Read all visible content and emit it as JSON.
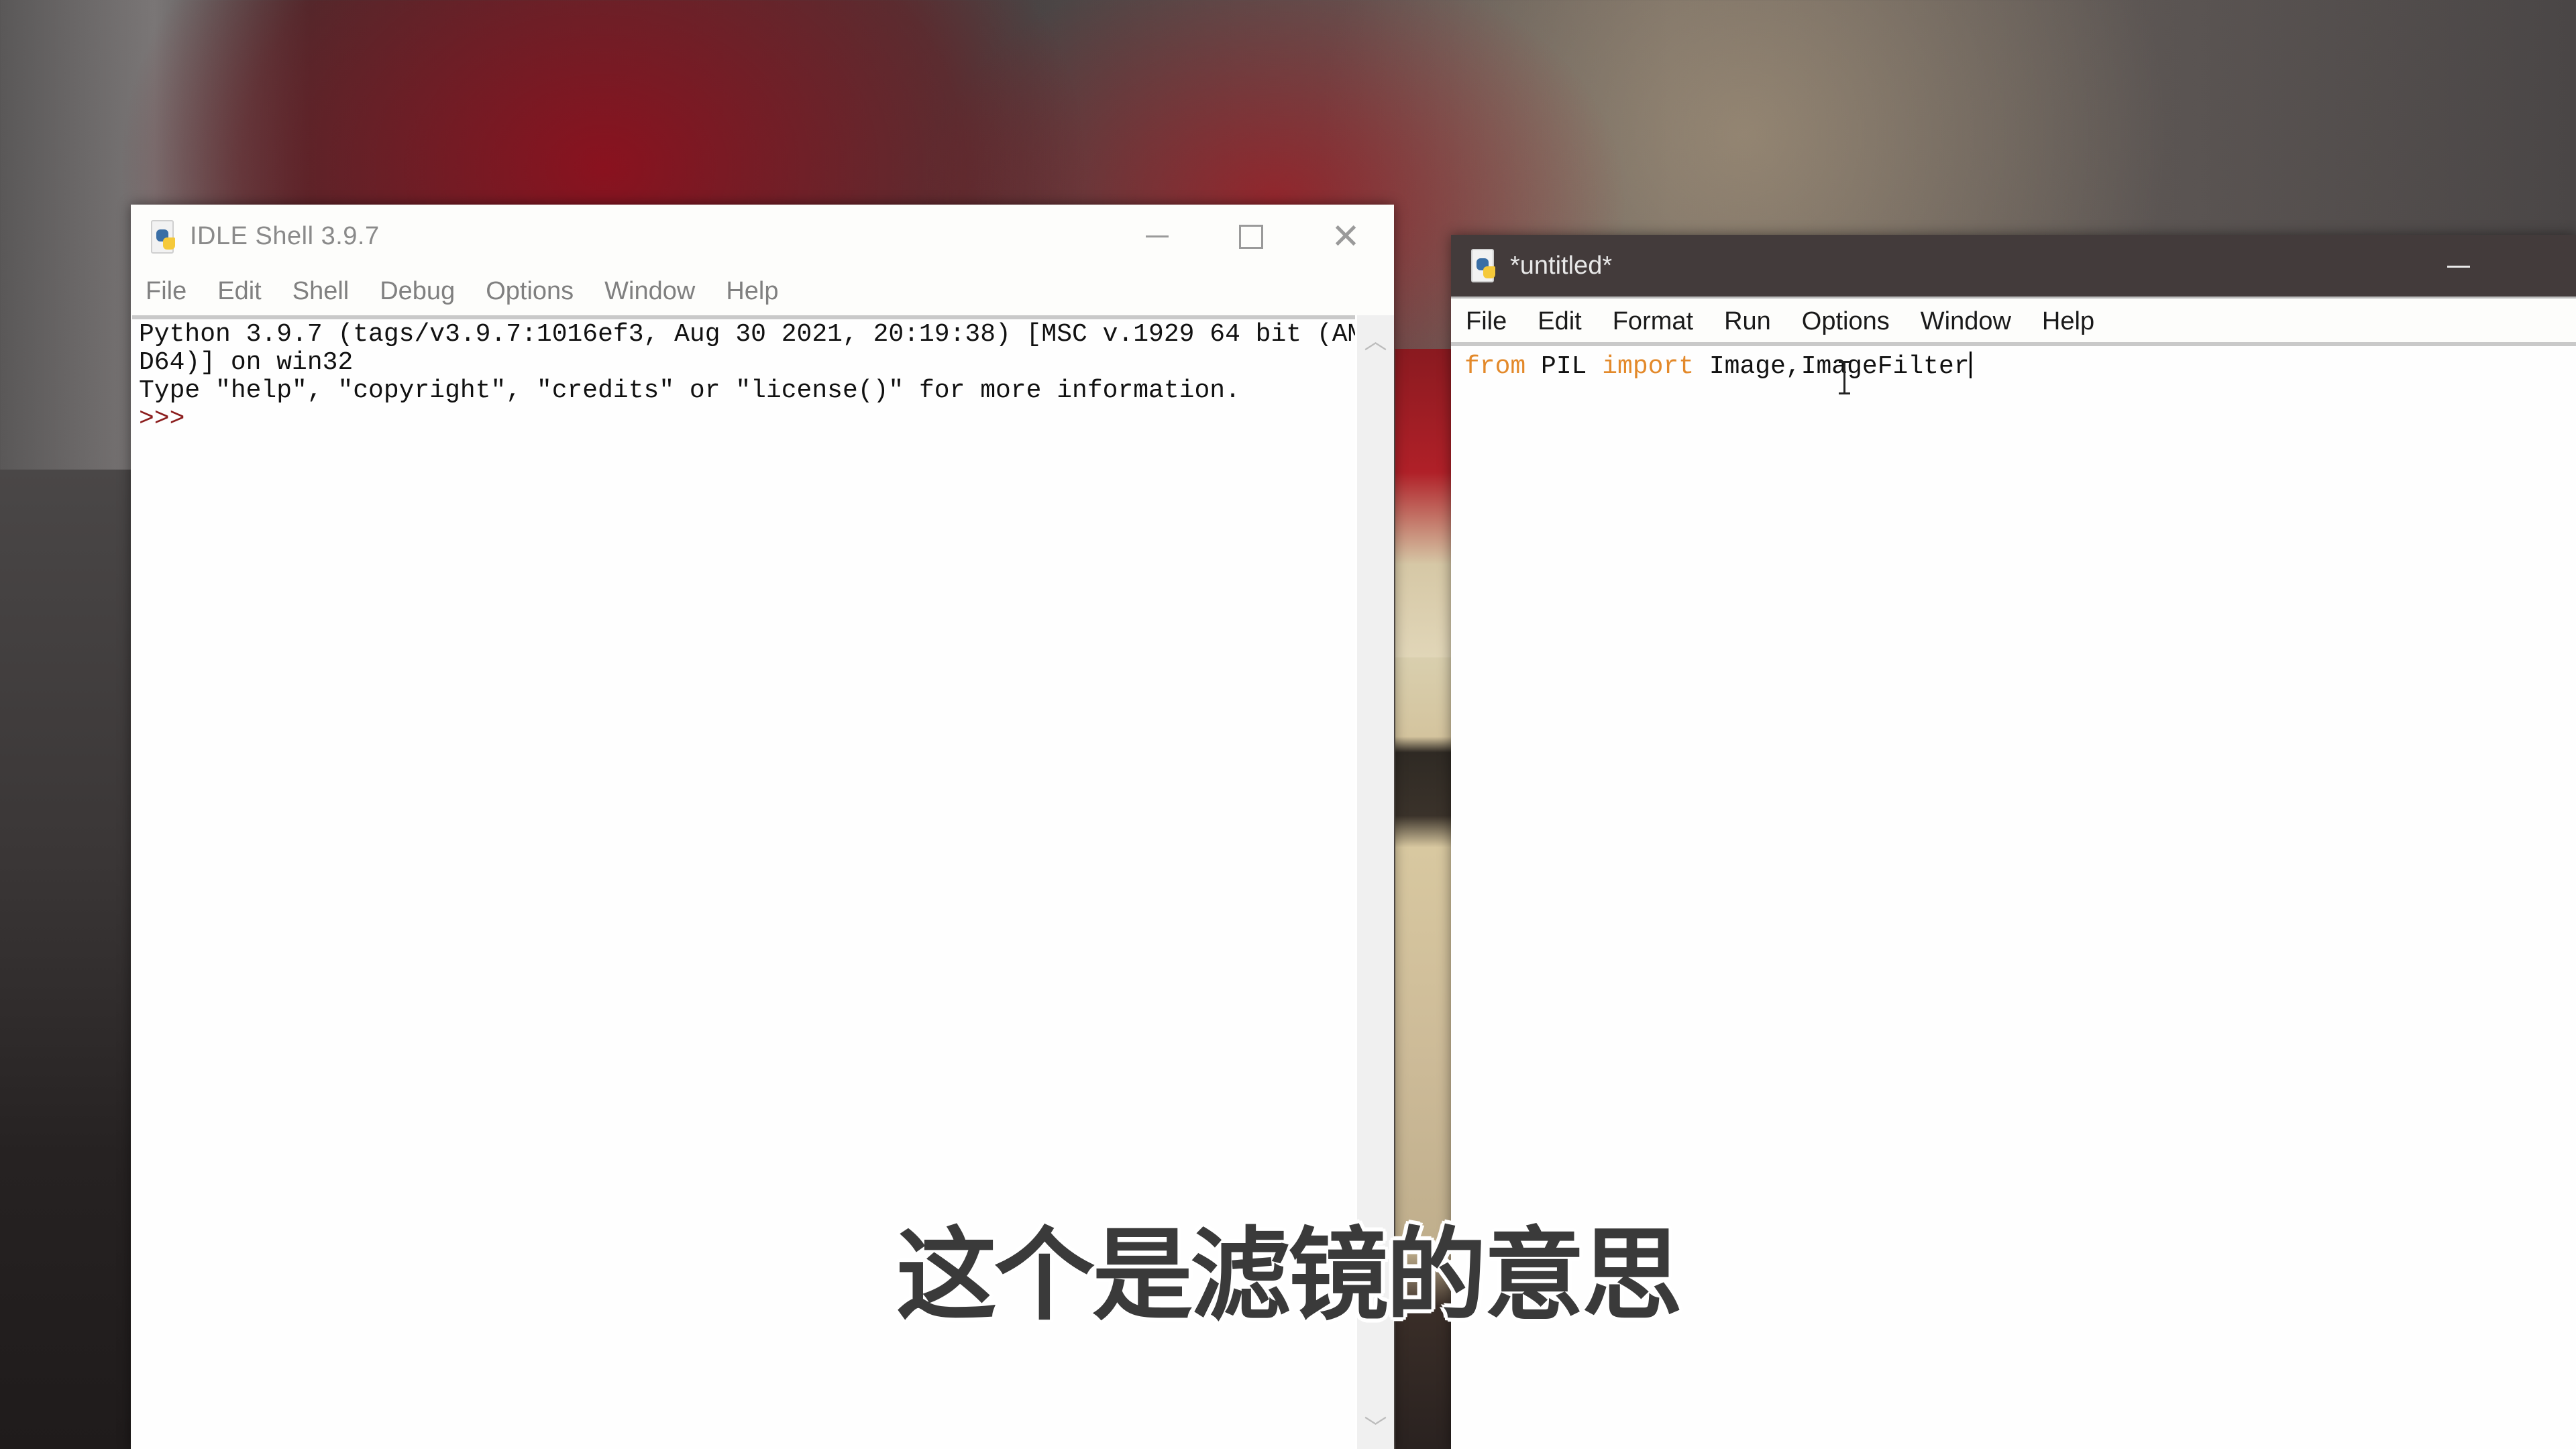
{
  "shell_window": {
    "title": "IDLE Shell 3.9.7",
    "menu": [
      "File",
      "Edit",
      "Shell",
      "Debug",
      "Options",
      "Window",
      "Help"
    ],
    "output_lines": [
      "Python 3.9.7 (tags/v3.9.7:1016ef3, Aug 30 2021, 20:19:38) [MSC v.1929 64 bit (AM",
      "D64)] on win32",
      "Type \"help\", \"copyright\", \"credits\" or \"license()\" for more information."
    ],
    "prompt": ">>>",
    "window_buttons": {
      "minimize": "minimize-icon",
      "maximize": "maximize-icon",
      "close": "close-icon"
    }
  },
  "editor_window": {
    "title": "*untitled*",
    "menu": [
      "File",
      "Edit",
      "Format",
      "Run",
      "Options",
      "Window",
      "Help"
    ],
    "code": {
      "kw1": "from",
      "module": " PIL ",
      "kw2": "import",
      "names": " Image,ImageFilter"
    },
    "colors": {
      "keyword": "#e3892a",
      "titlebar": "#433b3b"
    }
  },
  "subtitle": "这个是滤镜的意思",
  "colors": {
    "prompt": "#8b1c1c"
  }
}
